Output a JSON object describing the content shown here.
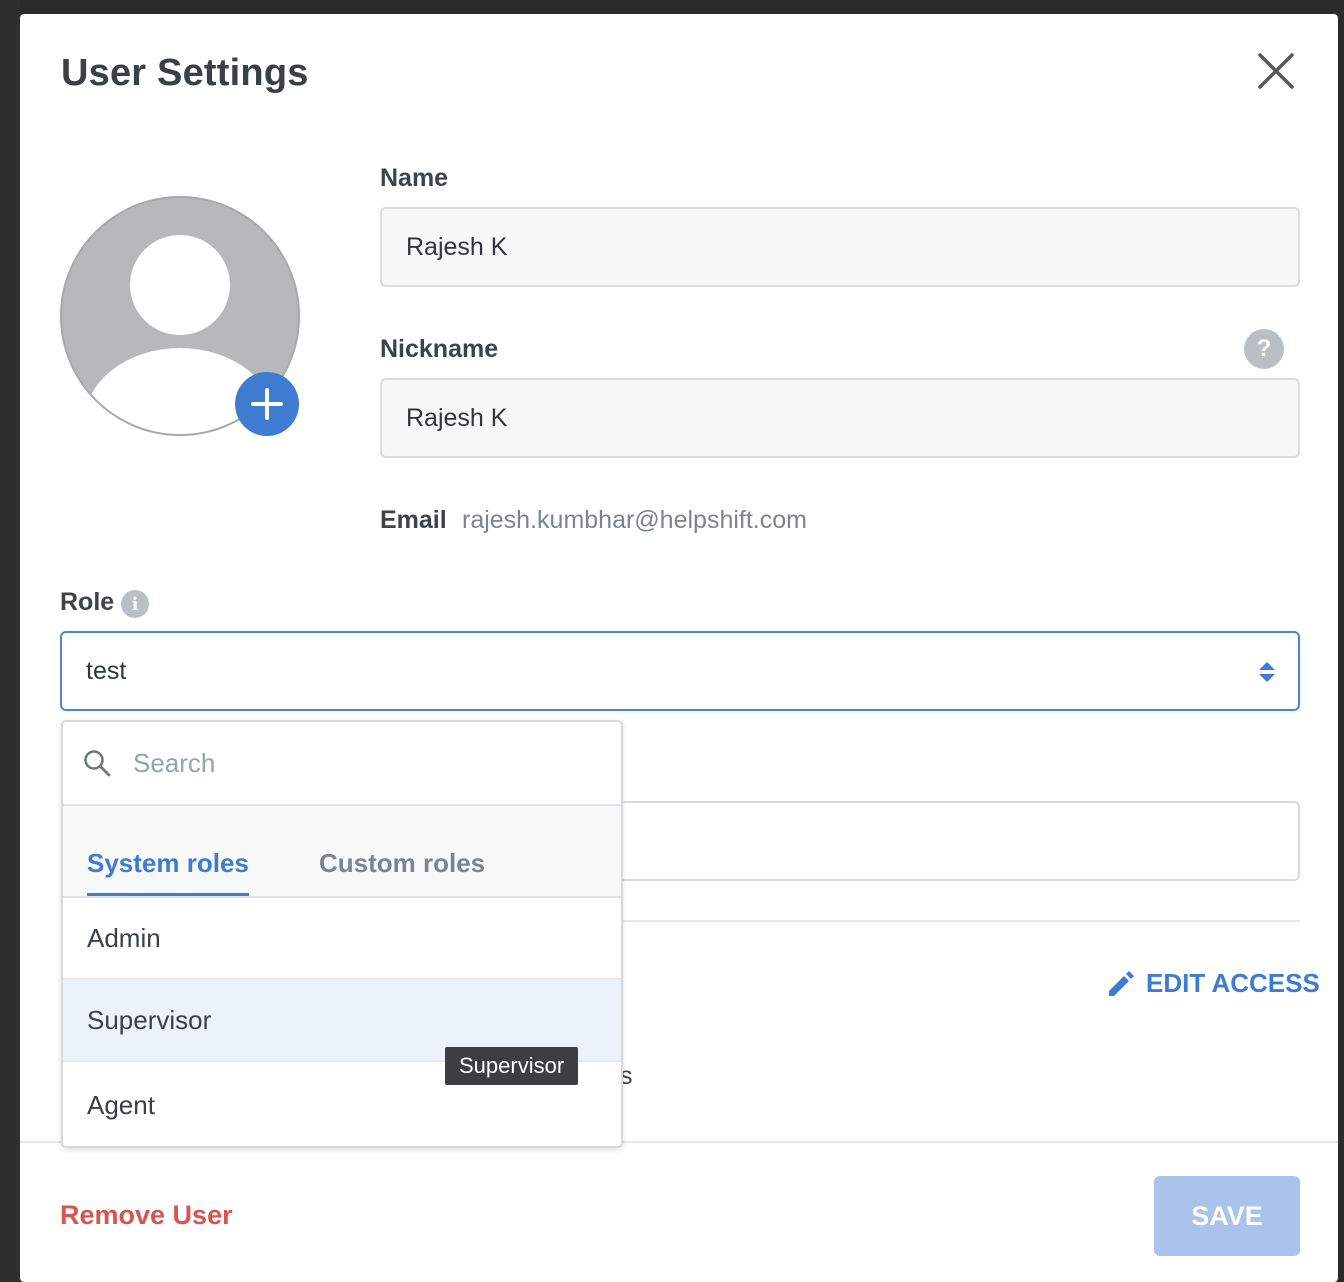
{
  "dialog": {
    "title": "User Settings",
    "close_icon": "close-icon"
  },
  "profile": {
    "avatar_icon": "avatar-placeholder-icon",
    "add_photo_icon": "plus-icon"
  },
  "form": {
    "name_label": "Name",
    "name_value": "Rajesh K",
    "nickname_label": "Nickname",
    "nickname_value": "Rajesh K",
    "help_icon_text": "?",
    "email_label": "Email",
    "email_value": "rajesh.kumbhar@helpshift.com",
    "role_label": "Role",
    "role_info_icon_text": "i",
    "role_value": "test"
  },
  "role_dropdown": {
    "search_placeholder": "Search",
    "tabs": [
      {
        "label": "System roles",
        "active": true
      },
      {
        "label": "Custom roles",
        "active": false
      }
    ],
    "options": [
      {
        "label": "Admin"
      },
      {
        "label": "Supervisor",
        "hovered": true
      },
      {
        "label": "Agent"
      }
    ],
    "tooltip": "Supervisor"
  },
  "access": {
    "edit_label": "EDIT ACCESS",
    "partially_hidden_text": "s"
  },
  "footer": {
    "remove_label": "Remove User",
    "save_label": "SAVE"
  },
  "colors": {
    "accent": "#3f7bd1",
    "danger": "#d9534f",
    "save_disabled": "#a9c3ec",
    "hover_row": "#ebf2fc"
  }
}
